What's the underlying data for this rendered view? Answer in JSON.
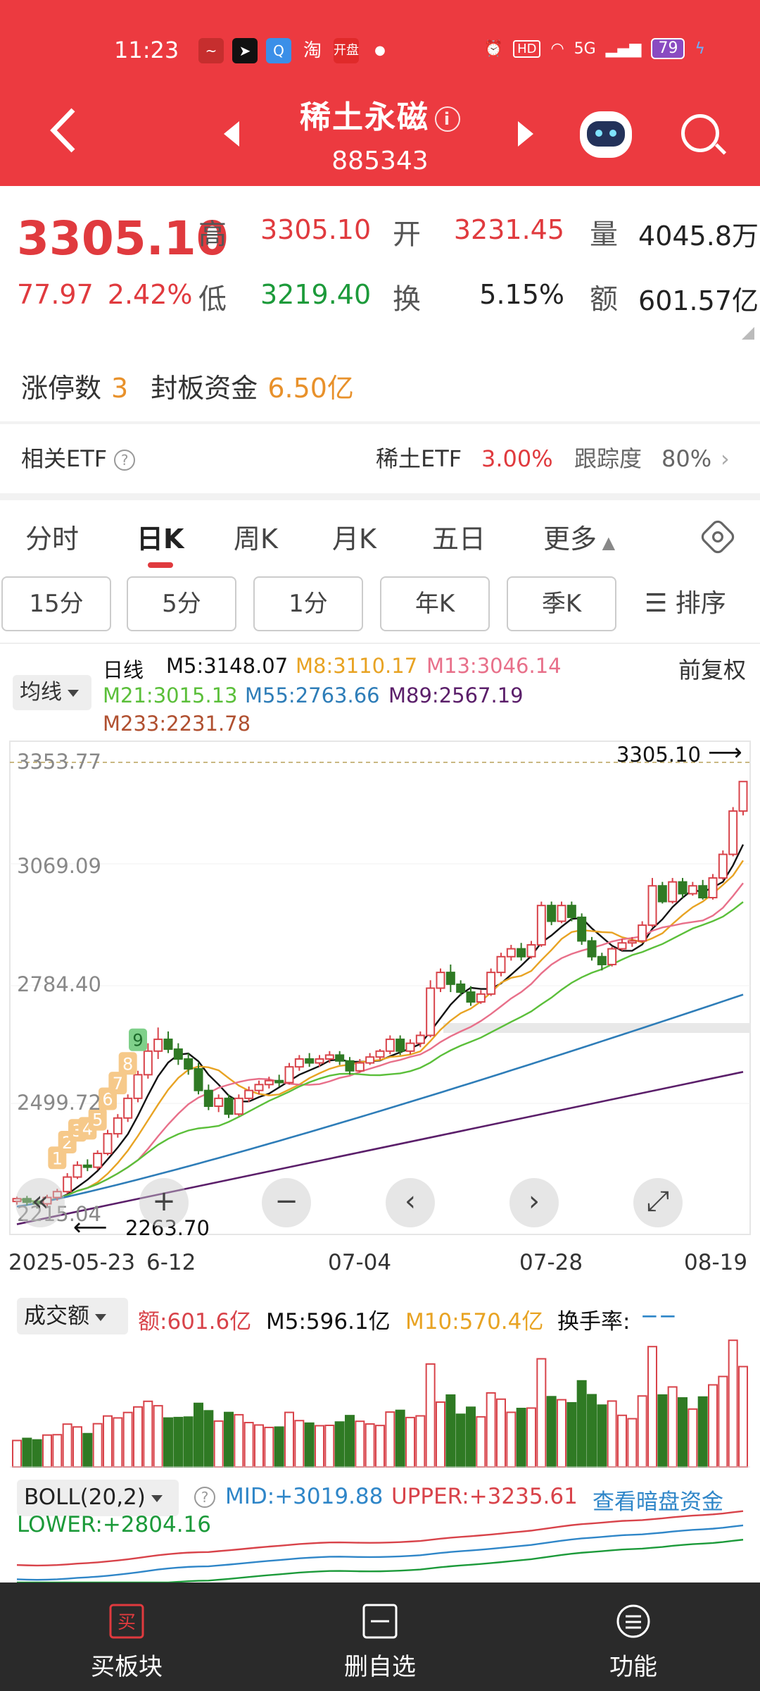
{
  "status_bar": {
    "time": "11:23",
    "network": "5G",
    "battery": "79"
  },
  "header": {
    "name": "稀土永磁",
    "code": "885343"
  },
  "quote": {
    "price": "3305.10",
    "change": "77.97",
    "change_pct": "2.42%",
    "high_label": "高",
    "high": "3305.10",
    "open_label": "开",
    "open": "3231.45",
    "volume_label": "量",
    "volume": "4045.8万",
    "low_label": "低",
    "low": "3219.40",
    "turnover_label": "换",
    "turnover": "5.15%",
    "amount_label": "额",
    "amount": "601.57亿"
  },
  "limit_up": {
    "label": "涨停数",
    "value": "3",
    "seal_label": "封板资金",
    "seal_value": "6.50亿"
  },
  "etf": {
    "label": "相关ETF",
    "name": "稀土ETF",
    "pct": "3.00%",
    "track_label": "跟踪度",
    "track": "80%"
  },
  "tabs": [
    "分时",
    "日K",
    "周K",
    "月K",
    "五日",
    "更多"
  ],
  "subtabs": [
    "15分",
    "5分",
    "1分",
    "年K",
    "季K"
  ],
  "sort_label": "排序",
  "ma_select": "均线",
  "fq_label": "前复权",
  "ma": {
    "line": "日线",
    "m5": "M5:3148.07",
    "m8": "M8:3110.17",
    "m13": "M13:3046.14",
    "m21": "M21:3015.13",
    "m55": "M55:2763.66",
    "m89": "M89:2567.19",
    "m233": "M233:2231.78"
  },
  "colors": {
    "m5": "#111111",
    "m8": "#e8a323",
    "m13": "#e8708a",
    "m21": "#5bbf3a",
    "m55": "#2e7db8",
    "m89": "#5b1f6a",
    "m233": "#b05030",
    "up": "#d8434a",
    "down": "#2f7a24"
  },
  "price_axis": [
    "3353.77",
    "3069.09",
    "2784.40",
    "2499.72",
    "2215.04"
  ],
  "high_marker": "3305.10",
  "low_marker": "2263.70",
  "x_axis": [
    "2025-05-23",
    "6-12",
    "07-04",
    "07-28",
    "08-19"
  ],
  "td_labels": [
    "1",
    "2",
    "3",
    "4",
    "5",
    "6",
    "7",
    "8",
    "9"
  ],
  "controls": [
    "«",
    "+",
    "−",
    "‹",
    "›",
    "⤢"
  ],
  "volume": {
    "select": "成交额",
    "amount": "额:601.6亿",
    "m5": "M5:596.1亿",
    "m10": "M10:570.4亿",
    "turnover": "换手率:",
    "turnover_value": "−−"
  },
  "boll": {
    "select": "BOLL(20,2)",
    "mid": "MID:+3019.88",
    "upper": "UPPER:+3235.61",
    "link": "查看暗盘资金",
    "lower": "LOWER:+2804.16"
  },
  "bottom_bar": [
    "买板块",
    "删自选",
    "功能"
  ],
  "chart_data": {
    "type": "candlestick",
    "ylim": [
      2215.04,
      3353.77
    ],
    "candles": [
      [
        2238,
        2245,
        2230,
        2250
      ],
      [
        2245,
        2236,
        2228,
        2252
      ],
      [
        2236,
        2232,
        2220,
        2240
      ],
      [
        2232,
        2248,
        2225,
        2255
      ],
      [
        2248,
        2263,
        2240,
        2270
      ],
      [
        2263,
        2300,
        2258,
        2310
      ],
      [
        2300,
        2330,
        2295,
        2340
      ],
      [
        2330,
        2325,
        2315,
        2345
      ],
      [
        2325,
        2360,
        2318,
        2368
      ],
      [
        2360,
        2410,
        2355,
        2420
      ],
      [
        2410,
        2450,
        2400,
        2460
      ],
      [
        2450,
        2500,
        2440,
        2510
      ],
      [
        2500,
        2560,
        2490,
        2570
      ],
      [
        2560,
        2620,
        2550,
        2640
      ],
      [
        2620,
        2650,
        2600,
        2680
      ],
      [
        2650,
        2625,
        2615,
        2670
      ],
      [
        2625,
        2600,
        2585,
        2640
      ],
      [
        2600,
        2575,
        2560,
        2615
      ],
      [
        2575,
        2520,
        2510,
        2590
      ],
      [
        2520,
        2480,
        2470,
        2535
      ],
      [
        2480,
        2500,
        2465,
        2510
      ],
      [
        2500,
        2460,
        2450,
        2510
      ],
      [
        2460,
        2500,
        2455,
        2510
      ],
      [
        2500,
        2520,
        2490,
        2530
      ],
      [
        2520,
        2535,
        2510,
        2545
      ],
      [
        2535,
        2545,
        2525,
        2555
      ],
      [
        2545,
        2540,
        2530,
        2560
      ],
      [
        2540,
        2580,
        2535,
        2590
      ],
      [
        2580,
        2600,
        2570,
        2610
      ],
      [
        2600,
        2590,
        2580,
        2615
      ],
      [
        2590,
        2600,
        2580,
        2610
      ],
      [
        2600,
        2610,
        2590,
        2620
      ],
      [
        2610,
        2595,
        2585,
        2620
      ],
      [
        2595,
        2570,
        2560,
        2605
      ],
      [
        2570,
        2590,
        2565,
        2600
      ],
      [
        2590,
        2605,
        2585,
        2615
      ],
      [
        2605,
        2620,
        2598,
        2625
      ],
      [
        2620,
        2650,
        2612,
        2660
      ],
      [
        2650,
        2620,
        2610,
        2660
      ],
      [
        2620,
        2640,
        2612,
        2650
      ],
      [
        2640,
        2660,
        2630,
        2670
      ],
      [
        2660,
        2780,
        2655,
        2800
      ],
      [
        2780,
        2820,
        2770,
        2830
      ],
      [
        2820,
        2790,
        2770,
        2840
      ],
      [
        2790,
        2770,
        2760,
        2800
      ],
      [
        2770,
        2745,
        2735,
        2785
      ],
      [
        2745,
        2765,
        2740,
        2775
      ],
      [
        2765,
        2820,
        2760,
        2830
      ],
      [
        2820,
        2860,
        2810,
        2870
      ],
      [
        2860,
        2880,
        2850,
        2890
      ],
      [
        2880,
        2860,
        2850,
        2895
      ],
      [
        2860,
        2890,
        2855,
        2900
      ],
      [
        2890,
        2990,
        2885,
        3000
      ],
      [
        2990,
        2950,
        2940,
        3000
      ],
      [
        2950,
        2990,
        2945,
        3000
      ],
      [
        2990,
        2960,
        2950,
        3000
      ],
      [
        2960,
        2900,
        2890,
        2970
      ],
      [
        2900,
        2860,
        2850,
        2910
      ],
      [
        2860,
        2840,
        2825,
        2870
      ],
      [
        2840,
        2880,
        2835,
        2885
      ],
      [
        2880,
        2895,
        2875,
        2905
      ],
      [
        2895,
        2900,
        2885,
        2910
      ],
      [
        2900,
        2940,
        2895,
        2950
      ],
      [
        2940,
        3040,
        2935,
        3060
      ],
      [
        3040,
        3000,
        2995,
        3050
      ],
      [
        3000,
        3050,
        2995,
        3060
      ],
      [
        3050,
        3020,
        3010,
        3060
      ],
      [
        3020,
        3040,
        3015,
        3050
      ],
      [
        3040,
        3010,
        3005,
        3055
      ],
      [
        3010,
        3060,
        3005,
        3070
      ],
      [
        3060,
        3120,
        3055,
        3130
      ],
      [
        3120,
        3230,
        3115,
        3240
      ],
      [
        3230,
        3305,
        3219,
        3305
      ]
    ]
  }
}
